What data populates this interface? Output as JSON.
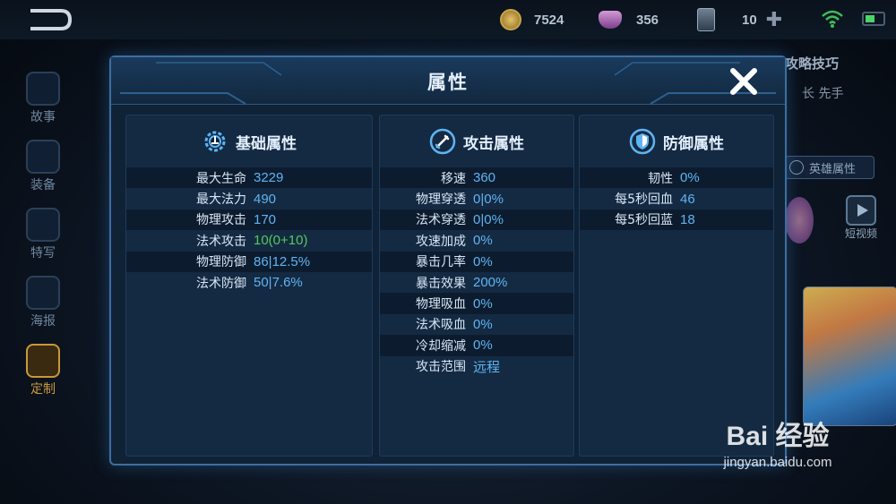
{
  "topbar": {
    "gold": "7524",
    "diamonds": "356",
    "cards": "10"
  },
  "sidebar": {
    "items": [
      {
        "label": "故事"
      },
      {
        "label": "装备"
      },
      {
        "label": "特写"
      },
      {
        "label": "海报"
      },
      {
        "label": "定制"
      }
    ]
  },
  "right_panel": {
    "tips_title": "攻略技巧",
    "tips_sub": "长 先手",
    "hero_attr_button": "英雄属性",
    "video_label": "短视频"
  },
  "modal": {
    "title": "属性",
    "columns": [
      {
        "title": "基础属性",
        "icon": "gear-icon",
        "rows": [
          {
            "label": "最大生命",
            "value": "3229"
          },
          {
            "label": "最大法力",
            "value": "490"
          },
          {
            "label": "物理攻击",
            "value": "170"
          },
          {
            "label": "法术攻击",
            "value": "10(0+10)"
          },
          {
            "label": "物理防御",
            "value": "86|12.5%"
          },
          {
            "label": "法术防御",
            "value": "50|7.6%"
          }
        ]
      },
      {
        "title": "攻击属性",
        "icon": "sword-icon",
        "rows": [
          {
            "label": "移速",
            "value": "360"
          },
          {
            "label": "物理穿透",
            "value": "0|0%"
          },
          {
            "label": "法术穿透",
            "value": "0|0%"
          },
          {
            "label": "攻速加成",
            "value": "0%"
          },
          {
            "label": "暴击几率",
            "value": "0%"
          },
          {
            "label": "暴击效果",
            "value": "200%"
          },
          {
            "label": "物理吸血",
            "value": "0%"
          },
          {
            "label": "法术吸血",
            "value": "0%"
          },
          {
            "label": "冷却缩减",
            "value": "0%"
          },
          {
            "label": "攻击范围",
            "value": "远程"
          }
        ]
      },
      {
        "title": "防御属性",
        "icon": "shield-icon",
        "rows": [
          {
            "label": "韧性",
            "value": "0%"
          },
          {
            "label": "每5秒回血",
            "value": "46"
          },
          {
            "label": "每5秒回蓝",
            "value": "18"
          }
        ]
      }
    ]
  },
  "watermark": {
    "brand": "Bai 经验",
    "url": "jingyan.baidu.com"
  },
  "colors": {
    "value_blue": "#5fb4f2",
    "bonus_green": "#58c85a",
    "panel_border": "#3d6f9f"
  }
}
